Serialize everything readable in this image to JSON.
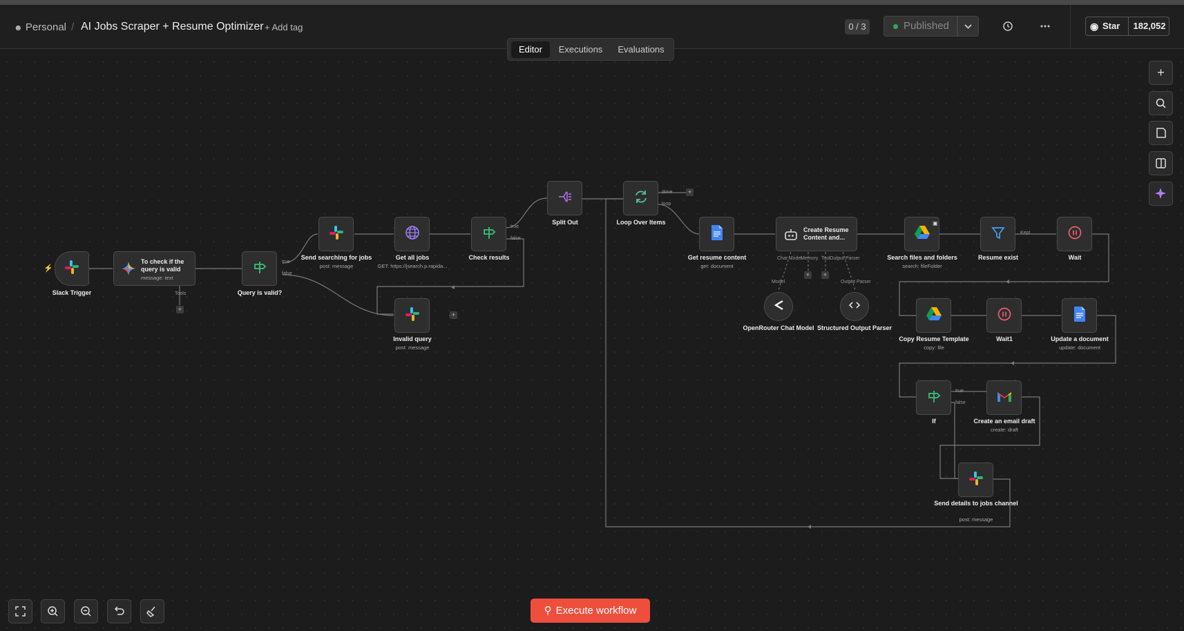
{
  "header": {
    "project": "Personal",
    "separator": "/",
    "title": "AI Jobs Scraper + Resume Optimizer",
    "add_tag": "+ Add tag",
    "counter": "0 / 3",
    "published": "Published",
    "github_star": "Star",
    "github_count": "182,052"
  },
  "tabs": [
    "Editor",
    "Executions",
    "Evaluations"
  ],
  "execute_label": "Execute workflow",
  "nodes": {
    "slack_trigger": {
      "label": "Slack Trigger"
    },
    "gemini": {
      "label": "To check if the query is valid",
      "sub": "message: text",
      "port": "Tools"
    },
    "query_valid": {
      "label": "Query is valid?",
      "true": "true",
      "false": "false"
    },
    "send_searching": {
      "label": "Send searching for jobs",
      "sub": "post: message"
    },
    "get_jobs": {
      "label": "Get all jobs",
      "sub": "GET: https://jsearch.p.rapida..."
    },
    "check_results": {
      "label": "Check results",
      "true": "true",
      "false": "false"
    },
    "invalid_query": {
      "label": "Invalid query",
      "sub": "post: message"
    },
    "split_out": {
      "label": "Split Out"
    },
    "loop": {
      "label": "Loop Over Items",
      "done": "done",
      "loop": "loop"
    },
    "get_resume": {
      "label": "Get resume content",
      "sub": "get: document"
    },
    "create_resume": {
      "label": "Create Resume Content and...",
      "p1": "Chat Model",
      "p2": "Memory",
      "p3": "Tool",
      "p4": "Output Parser"
    },
    "openrouter": {
      "label": "OpenRouter Chat Model",
      "port": "Model"
    },
    "structured": {
      "label": "Structured Output Parser",
      "port": "Output Parser"
    },
    "search_files": {
      "label": "Search files and folders",
      "sub": "search: fileFolder"
    },
    "resume_exist": {
      "label": "Resume exist",
      "kept": "Kept"
    },
    "wait": {
      "label": "Wait"
    },
    "copy_template": {
      "label": "Copy Resume Template",
      "sub": "copy: file"
    },
    "wait1": {
      "label": "Wait1"
    },
    "update_doc": {
      "label": "Update a document",
      "sub": "update: document"
    },
    "if_node": {
      "label": "If",
      "true": "true",
      "false": "false"
    },
    "email_draft": {
      "label": "Create an email draft",
      "sub": "create: draft"
    },
    "send_details": {
      "label": "Send details to jobs channel",
      "sub": "post: message"
    }
  },
  "icons": {
    "slack_colors": [
      "#36c5f0",
      "#2eb67d",
      "#ecb22e",
      "#e01e5a"
    ],
    "if_color": "#35c27a",
    "http_color": "#9a7cf0",
    "split_color": "#a56ad8",
    "loop_color": "#4fc3a1",
    "docs_color": "#4285f4",
    "filter_color": "#4a9ff5",
    "wait_color": "#ee5c75",
    "accent": "#ee4f3d"
  }
}
